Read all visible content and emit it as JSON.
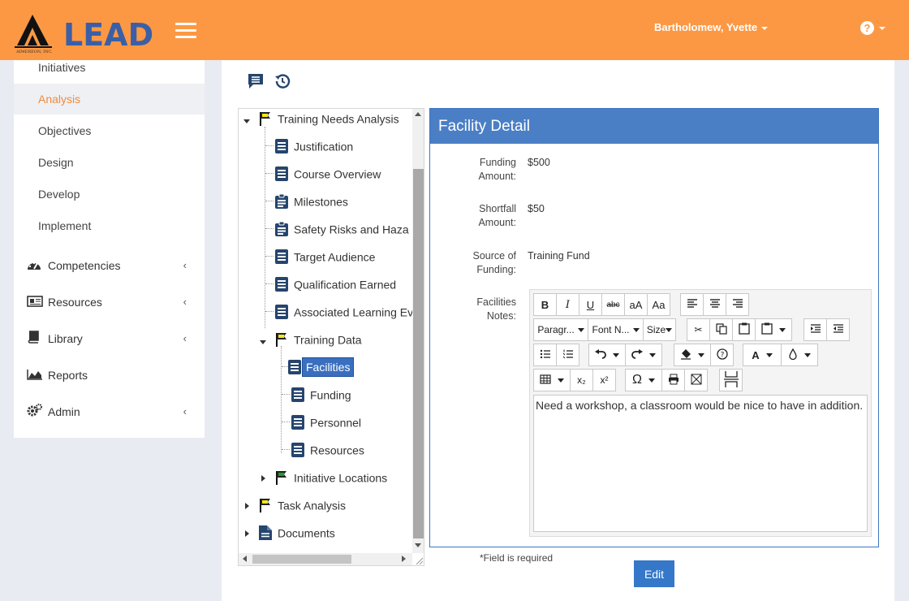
{
  "header": {
    "logo_text": "LEAD",
    "logo_subtext": "AIMEREON, INC.",
    "user_name": "Bartholomew, Yvette",
    "help_glyph": "?"
  },
  "colors": {
    "topbar": "#fc9844",
    "accent": "#f08b3d",
    "panel_header": "#4b7fc5",
    "button": "#3577c8"
  },
  "sidebar": {
    "sub_items": [
      {
        "label": "Initiatives"
      },
      {
        "label": "Analysis",
        "active": true
      },
      {
        "label": "Objectives"
      },
      {
        "label": "Design"
      },
      {
        "label": "Develop"
      },
      {
        "label": "Implement"
      }
    ],
    "main_items": [
      {
        "label": "Competencies",
        "icon": "dashboard-icon",
        "chevron": "‹"
      },
      {
        "label": "Resources",
        "icon": "newspaper-icon",
        "chevron": "‹"
      },
      {
        "label": "Library",
        "icon": "book-icon",
        "chevron": "‹"
      },
      {
        "label": "Reports",
        "icon": "area-chart-icon"
      },
      {
        "label": "Admin",
        "icon": "gears-icon",
        "chevron": "‹"
      }
    ]
  },
  "tree": {
    "items": [
      {
        "label": "Training Needs Analysis",
        "icon": "yellow-flag-icon"
      },
      {
        "label": "Justification",
        "icon": "document-list-icon"
      },
      {
        "label": "Course Overview",
        "icon": "document-list-icon"
      },
      {
        "label": "Milestones",
        "icon": "clipboard-icon"
      },
      {
        "label": "Safety Risks and Haza",
        "icon": "clipboard-icon"
      },
      {
        "label": "Target Audience",
        "icon": "document-list-icon"
      },
      {
        "label": "Qualification Earned",
        "icon": "document-list-icon"
      },
      {
        "label": "Associated Learning Ev",
        "icon": "document-list-icon"
      },
      {
        "label": "Training Data",
        "icon": "yellow-flag-icon"
      },
      {
        "label": "Facilities",
        "icon": "document-list-icon",
        "selected": true
      },
      {
        "label": "Funding",
        "icon": "document-list-icon"
      },
      {
        "label": "Personnel",
        "icon": "document-list-icon"
      },
      {
        "label": "Resources",
        "icon": "document-list-icon"
      },
      {
        "label": "Initiative Locations",
        "icon": "green-flag-icon"
      },
      {
        "label": "Task Analysis",
        "icon": "yellow-flag-icon"
      },
      {
        "label": "Documents",
        "icon": "file-icon"
      }
    ]
  },
  "detail": {
    "title": "Facility Detail",
    "fields": [
      {
        "label_line1": "Funding",
        "label_line2": "Amount:",
        "value": "$500"
      },
      {
        "label_line1": "Shortfall",
        "label_line2": "Amount:",
        "value": "$50"
      },
      {
        "label_line1": "Source of",
        "label_line2": "Funding:",
        "value": "Training Fund"
      }
    ],
    "notes_label_line1": "Facilities",
    "notes_label_line2": "Notes:",
    "notes_text": "Need a workshop, a classroom would be nice to have in addition.",
    "toolbar": {
      "bold": "B",
      "italic": "I",
      "underline": "U",
      "strike": "abc",
      "case_toggle": "aA",
      "case_title": "Aa",
      "paragraph": "Paragr...",
      "font_name": "Font N...",
      "size": "Size",
      "subscript": "x₂",
      "superscript": "x²",
      "font_color": "A",
      "omega": "Ω"
    }
  },
  "footer": {
    "required_note": "*Field is required",
    "edit_label": "Edit"
  }
}
